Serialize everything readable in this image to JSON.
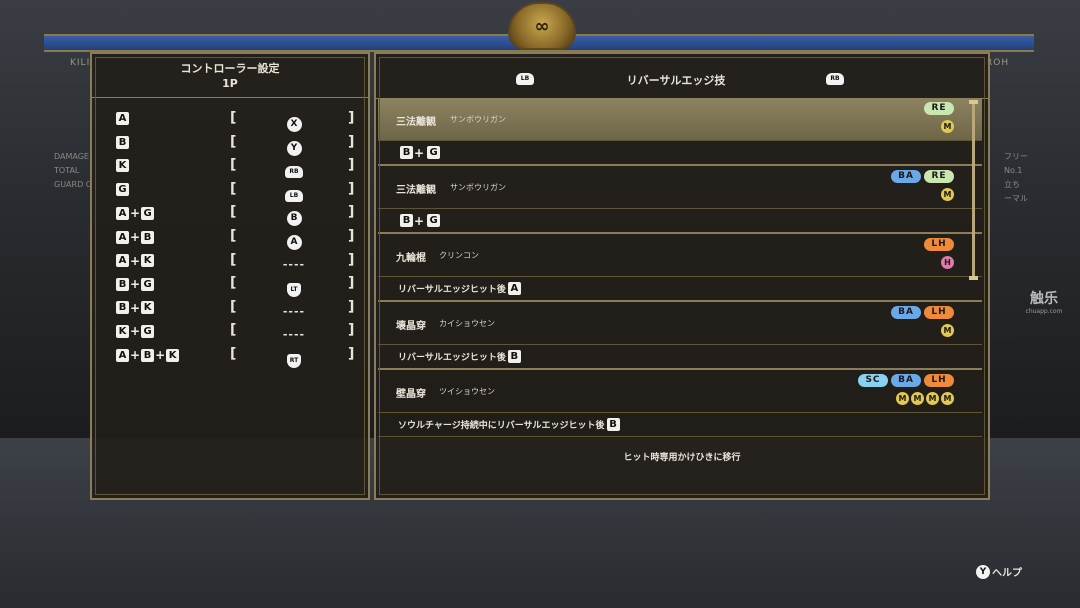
{
  "background": {
    "left_stats": [
      "DAMAGE",
      "TOTAL",
      "GUARD C"
    ],
    "right_stats": [
      "フリー",
      "No.1",
      "立ち",
      "ーマル"
    ],
    "left_tag": "KILI",
    "right_tag": "ROH",
    "emblem_glyph": "∞"
  },
  "watermark": {
    "main": "触乐",
    "sub": "chuapp.com"
  },
  "controller": {
    "title": "コントローラー設定",
    "player": "1P",
    "mappings": [
      {
        "combo": [
          "A"
        ],
        "pad": "X",
        "pad_type": "button"
      },
      {
        "combo": [
          "B"
        ],
        "pad": "Y",
        "pad_type": "button"
      },
      {
        "combo": [
          "K"
        ],
        "pad": "RB",
        "pad_type": "bumper"
      },
      {
        "combo": [
          "G"
        ],
        "pad": "LB",
        "pad_type": "bumper"
      },
      {
        "combo": [
          "A",
          "G"
        ],
        "pad": "B",
        "pad_type": "button"
      },
      {
        "combo": [
          "A",
          "B"
        ],
        "pad": "A",
        "pad_type": "button"
      },
      {
        "combo": [
          "A",
          "K"
        ],
        "pad": "----",
        "pad_type": "none"
      },
      {
        "combo": [
          "B",
          "G"
        ],
        "pad": "LT",
        "pad_type": "trigger"
      },
      {
        "combo": [
          "B",
          "K"
        ],
        "pad": "----",
        "pad_type": "none"
      },
      {
        "combo": [
          "K",
          "G"
        ],
        "pad": "----",
        "pad_type": "none"
      },
      {
        "combo": [
          "A",
          "B",
          "K"
        ],
        "pad": "RT",
        "pad_type": "trigger"
      }
    ]
  },
  "movelist": {
    "header": {
      "title": "リバーサルエッジ技",
      "lb": "LB",
      "rb": "RB"
    },
    "moves": [
      {
        "name": "三法離観",
        "reading": "サンボウリガン",
        "selected": true,
        "badges": [
          "RE"
        ],
        "levels": [
          "M"
        ],
        "input": {
          "text": "",
          "keys": [
            "B",
            "G"
          ]
        }
      },
      {
        "name": "三法離観",
        "reading": "サンボウリガン",
        "selected": false,
        "badges": [
          "BA",
          "RE"
        ],
        "levels": [
          "M"
        ],
        "input": {
          "text": "",
          "keys": [
            "B",
            "G"
          ]
        }
      },
      {
        "name": "九輪棍",
        "reading": "クリンコン",
        "selected": false,
        "badges": [
          "LH"
        ],
        "levels": [
          "H"
        ],
        "input": {
          "text": "リバーサルエッジヒット後",
          "keys": [
            "A"
          ]
        }
      },
      {
        "name": "壊晶穿",
        "reading": "カイショウセン",
        "selected": false,
        "badges": [
          "BA",
          "LH"
        ],
        "levels": [
          "M"
        ],
        "input": {
          "text": "リバーサルエッジヒット後",
          "keys": [
            "B"
          ]
        }
      },
      {
        "name": "壁晶穿",
        "reading": "ツイショウセン",
        "selected": false,
        "badges": [
          "SC",
          "BA",
          "LH"
        ],
        "levels": [
          "M",
          "M",
          "M",
          "M"
        ],
        "input": {
          "text": "ソウルチャージ持続中にリバーサルエッジヒット後",
          "keys": [
            "B"
          ]
        }
      }
    ],
    "note": "ヒット時専用かけひきに移行"
  },
  "help": {
    "button": "Y",
    "label": "ヘルプ"
  },
  "colors": {
    "frame": "#8b7d5a",
    "re": "#c8e8b0",
    "ba": "#6aa8e8",
    "lh": "#ee8a3a",
    "sc": "#8ad0f0",
    "m": "#e2c850",
    "h": "#e07aa8"
  }
}
